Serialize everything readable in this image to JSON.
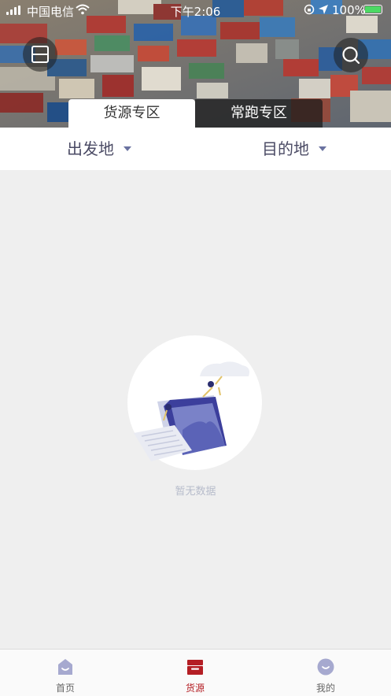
{
  "status_bar": {
    "carrier": "中国电信",
    "time": "下午2:06",
    "battery": "100%"
  },
  "header": {
    "menu_icon": "menu-icon",
    "search_icon": "search-icon",
    "tabs": [
      {
        "label": "货源专区",
        "active": true
      },
      {
        "label": "常跑专区",
        "active": false
      }
    ]
  },
  "filters": {
    "origin_label": "出发地",
    "destination_label": "目的地"
  },
  "empty_state": {
    "message": "暂无数据"
  },
  "tab_bar": {
    "items": [
      {
        "label": "首页",
        "icon": "home-icon",
        "active": false
      },
      {
        "label": "货源",
        "icon": "cargo-icon",
        "active": true
      },
      {
        "label": "我的",
        "icon": "profile-icon",
        "active": false
      }
    ],
    "active_color": "#b41e24"
  },
  "colors": {
    "accent": "#b41e24",
    "filter_text": "#4a4a64",
    "illustration": "#5b63b7"
  }
}
